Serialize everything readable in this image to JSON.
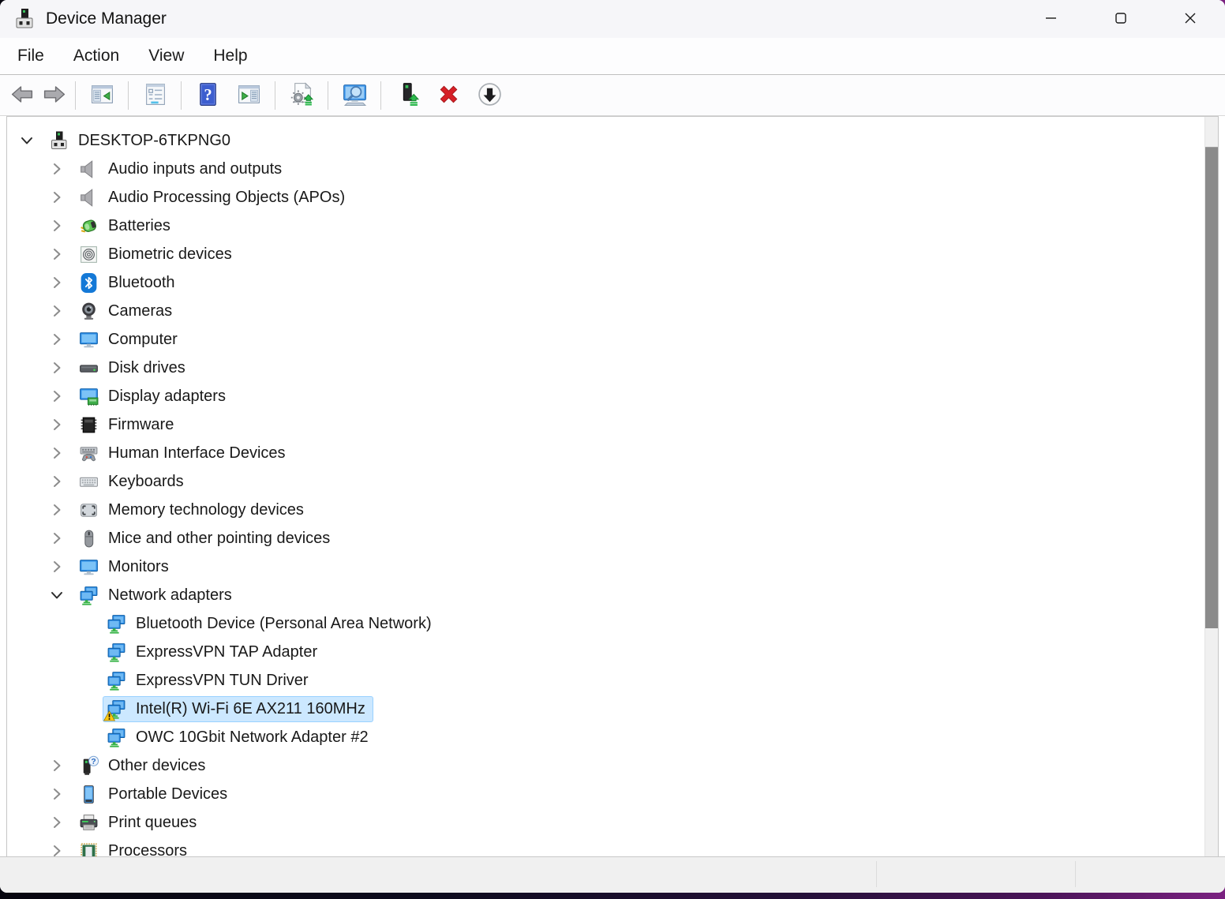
{
  "window": {
    "title": "Device Manager",
    "icon": "device-manager",
    "controls": [
      {
        "icon": "minimize"
      },
      {
        "icon": "maximize"
      },
      {
        "icon": "close"
      }
    ]
  },
  "menubar": {
    "items": [
      {
        "label": "File"
      },
      {
        "label": "Action"
      },
      {
        "label": "View"
      },
      {
        "label": "Help"
      }
    ]
  },
  "toolbar": {
    "items": [
      {
        "type": "button",
        "icon": "back-arrow"
      },
      {
        "type": "button",
        "icon": "forward-arrow"
      },
      {
        "type": "separator"
      },
      {
        "type": "button",
        "icon": "show-console-tree"
      },
      {
        "type": "separator"
      },
      {
        "type": "button",
        "icon": "properties"
      },
      {
        "type": "separator"
      },
      {
        "type": "button",
        "icon": "help"
      },
      {
        "type": "button",
        "icon": "show-action-pane"
      },
      {
        "type": "separator"
      },
      {
        "type": "button",
        "icon": "update-driver"
      },
      {
        "type": "separator"
      },
      {
        "type": "button",
        "icon": "scan-hardware-changes"
      },
      {
        "type": "separator"
      },
      {
        "type": "button",
        "icon": "add-driver"
      },
      {
        "type": "button",
        "icon": "uninstall-device"
      },
      {
        "type": "button",
        "icon": "disable-device"
      }
    ]
  },
  "tree": {
    "rows": [
      {
        "label": "DESKTOP-6TKPNG0",
        "icon": "computer-device",
        "level": 0,
        "expander": "expanded",
        "selected": false,
        "warning": false
      },
      {
        "label": "Audio inputs and outputs",
        "icon": "speaker",
        "level": 1,
        "expander": "collapsed",
        "selected": false,
        "warning": false
      },
      {
        "label": "Audio Processing Objects (APOs)",
        "icon": "speaker",
        "level": 1,
        "expander": "collapsed",
        "selected": false,
        "warning": false
      },
      {
        "label": "Batteries",
        "icon": "battery",
        "level": 1,
        "expander": "collapsed",
        "selected": false,
        "warning": false
      },
      {
        "label": "Biometric devices",
        "icon": "fingerprint",
        "level": 1,
        "expander": "collapsed",
        "selected": false,
        "warning": false
      },
      {
        "label": "Bluetooth",
        "icon": "bluetooth",
        "level": 1,
        "expander": "collapsed",
        "selected": false,
        "warning": false
      },
      {
        "label": "Cameras",
        "icon": "camera",
        "level": 1,
        "expander": "collapsed",
        "selected": false,
        "warning": false
      },
      {
        "label": "Computer",
        "icon": "monitor",
        "level": 1,
        "expander": "collapsed",
        "selected": false,
        "warning": false
      },
      {
        "label": "Disk drives",
        "icon": "disk-drive",
        "level": 1,
        "expander": "collapsed",
        "selected": false,
        "warning": false
      },
      {
        "label": "Display adapters",
        "icon": "display-adapter",
        "level": 1,
        "expander": "collapsed",
        "selected": false,
        "warning": false
      },
      {
        "label": "Firmware",
        "icon": "firmware-chip",
        "level": 1,
        "expander": "collapsed",
        "selected": false,
        "warning": false
      },
      {
        "label": "Human Interface Devices",
        "icon": "hid",
        "level": 1,
        "expander": "collapsed",
        "selected": false,
        "warning": false
      },
      {
        "label": "Keyboards",
        "icon": "keyboard",
        "level": 1,
        "expander": "collapsed",
        "selected": false,
        "warning": false
      },
      {
        "label": "Memory technology devices",
        "icon": "memory-card",
        "level": 1,
        "expander": "collapsed",
        "selected": false,
        "warning": false
      },
      {
        "label": "Mice and other pointing devices",
        "icon": "mouse",
        "level": 1,
        "expander": "collapsed",
        "selected": false,
        "warning": false
      },
      {
        "label": "Monitors",
        "icon": "monitor",
        "level": 1,
        "expander": "collapsed",
        "selected": false,
        "warning": false
      },
      {
        "label": "Network adapters",
        "icon": "network-adapter",
        "level": 1,
        "expander": "expanded",
        "selected": false,
        "warning": false
      },
      {
        "label": "Bluetooth Device (Personal Area Network)",
        "icon": "network-adapter",
        "level": 2,
        "expander": "none",
        "selected": false,
        "warning": false
      },
      {
        "label": "ExpressVPN TAP Adapter",
        "icon": "network-adapter",
        "level": 2,
        "expander": "none",
        "selected": false,
        "warning": false
      },
      {
        "label": "ExpressVPN TUN Driver",
        "icon": "network-adapter",
        "level": 2,
        "expander": "none",
        "selected": false,
        "warning": false
      },
      {
        "label": "Intel(R) Wi-Fi 6E AX211 160MHz",
        "icon": "network-adapter",
        "level": 2,
        "expander": "none",
        "selected": true,
        "warning": true
      },
      {
        "label": "OWC 10Gbit Network Adapter #2",
        "icon": "network-adapter",
        "level": 2,
        "expander": "none",
        "selected": false,
        "warning": false
      },
      {
        "label": "Other devices",
        "icon": "unknown-device",
        "level": 1,
        "expander": "collapsed",
        "selected": false,
        "warning": false
      },
      {
        "label": "Portable Devices",
        "icon": "portable-device",
        "level": 1,
        "expander": "collapsed",
        "selected": false,
        "warning": false
      },
      {
        "label": "Print queues",
        "icon": "printer",
        "level": 1,
        "expander": "collapsed",
        "selected": false,
        "warning": false
      },
      {
        "label": "Processors",
        "icon": "processor",
        "level": 1,
        "expander": "collapsed",
        "selected": false,
        "warning": false
      }
    ]
  },
  "statusbar": {
    "text": ""
  },
  "colors": {
    "selection_bg": "#cce8ff",
    "selection_border": "#99d1ff",
    "warning_yellow": "#fec80e",
    "uninstall_red": "#d62027"
  }
}
